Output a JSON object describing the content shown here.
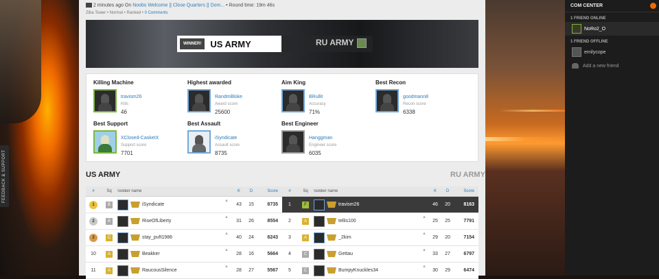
{
  "feedback": "FEEDBACK & SUPPORT",
  "meta": {
    "time": "2 minutes ago",
    "on": "On",
    "server": "Noobs Welcome || Close Quarters || Dom...",
    "round": "• Round time: 19m 46s",
    "line2_pre": "Ziba Tower • Normal • Ranked •",
    "comments": "0 Comments"
  },
  "banner": {
    "winner_tag": "WINNER!",
    "winner_team": "US ARMY",
    "loser_team": "RU ARMY"
  },
  "awards": [
    {
      "title": "Killing Machine",
      "player": "travism26",
      "label": "Kills",
      "value": "46",
      "frame": "green"
    },
    {
      "title": "Highest awarded",
      "player": "RandmBloke",
      "label": "Award score",
      "value": "25600",
      "frame": "blue"
    },
    {
      "title": "Aim King",
      "player": "BRullit",
      "label": "Accuracy",
      "value": "71%",
      "frame": "blue"
    },
    {
      "title": "Best Recon",
      "player": "goodmann8",
      "label": "Recon score",
      "value": "6338",
      "frame": "blue"
    },
    {
      "title": "Best Support",
      "player": "XClosed-CasketX",
      "label": "Support score",
      "value": "7701",
      "frame": "green"
    },
    {
      "title": "Best Assault",
      "player": "iSyndicate",
      "label": "Assault score",
      "value": "8735",
      "frame": "blue"
    },
    {
      "title": "Best Engineer",
      "player": "Hanggman",
      "label": "Engineer score",
      "value": "6035",
      "frame": "gray"
    }
  ],
  "teams": {
    "left_name": "US ARMY",
    "right_name": "RU ARMY",
    "headers": {
      "rank": "#",
      "sq": "Sq",
      "name": "Soldier name",
      "k": "K",
      "d": "D",
      "score": "Score"
    },
    "left_rows": [
      {
        "rank": "1",
        "sq": "B",
        "name": "iSyndicate",
        "k": "43",
        "d": "15",
        "score": "8735"
      },
      {
        "rank": "2",
        "sq": "B",
        "name": "RiseOfLiberty",
        "k": "31",
        "d": "26",
        "score": "8554"
      },
      {
        "rank": "3",
        "sq": "C",
        "name": "stay_puft1986",
        "k": "40",
        "d": "24",
        "score": "8243"
      },
      {
        "rank": "10",
        "sq": "A",
        "name": "Beakker",
        "k": "28",
        "d": "16",
        "score": "5664"
      },
      {
        "rank": "11",
        "sq": "A",
        "name": "RaucousSilence",
        "k": "28",
        "d": "27",
        "score": "5567"
      }
    ],
    "right_rows": [
      {
        "rank": "1",
        "sq": "F",
        "name": "travism26",
        "k": "46",
        "d": "20",
        "score": "8163"
      },
      {
        "rank": "2",
        "sq": "A",
        "name": "tellis100",
        "k": "25",
        "d": "25",
        "score": "7791"
      },
      {
        "rank": "3",
        "sq": "A",
        "name": "_2kim",
        "k": "29",
        "d": "20",
        "score": "7154"
      },
      {
        "rank": "4",
        "sq": "C",
        "name": "Gettau",
        "k": "33",
        "d": "27",
        "score": "6797"
      },
      {
        "rank": "5",
        "sq": "C",
        "name": "BumpyKnuckles34",
        "k": "30",
        "d": "29",
        "score": "6474"
      }
    ]
  },
  "com": {
    "title": "COM CENTER",
    "online_hdr": "1 FRIEND ONLINE",
    "online_friend": "NoRo2_O",
    "offline_hdr": "1 FRIEND OFFLINE",
    "offline_friend": "emilycope",
    "add": "Add a new friend"
  }
}
